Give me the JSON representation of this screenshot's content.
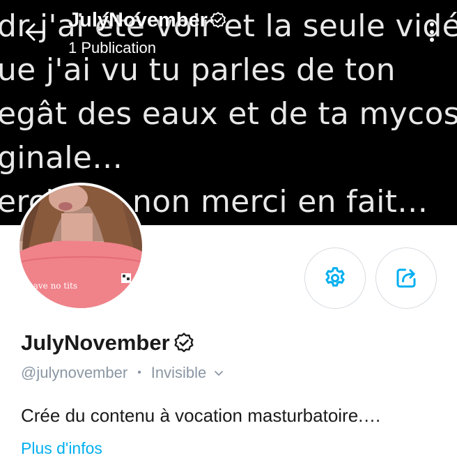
{
  "banner": {
    "lines": [
      "dr j'ai été voir et la seule vidéo",
      "ue j'ai vu tu parles de ton",
      "egât des eaux et de ta mycose",
      "ginale…",
      "erci bah non merci en fait…"
    ]
  },
  "header": {
    "back_icon": "arrow-left-icon",
    "title": "JulyNovember",
    "subtitle": "1 Publication",
    "more_icon": "more-vertical-icon"
  },
  "avatar": {
    "shirt_text": "have no tits"
  },
  "actions": {
    "settings_icon": "gear-icon",
    "share_icon": "share-icon"
  },
  "profile": {
    "name": "JulyNovember",
    "handle": "@julynovember",
    "separator": "•",
    "status": "Invisible",
    "bio": "Crée du contenu à vocation masturbatoire.…",
    "more_info": "Plus d'infos"
  },
  "colors": {
    "accent": "#00aff0",
    "muted": "#8a96a3",
    "text": "#1a1a1a"
  }
}
